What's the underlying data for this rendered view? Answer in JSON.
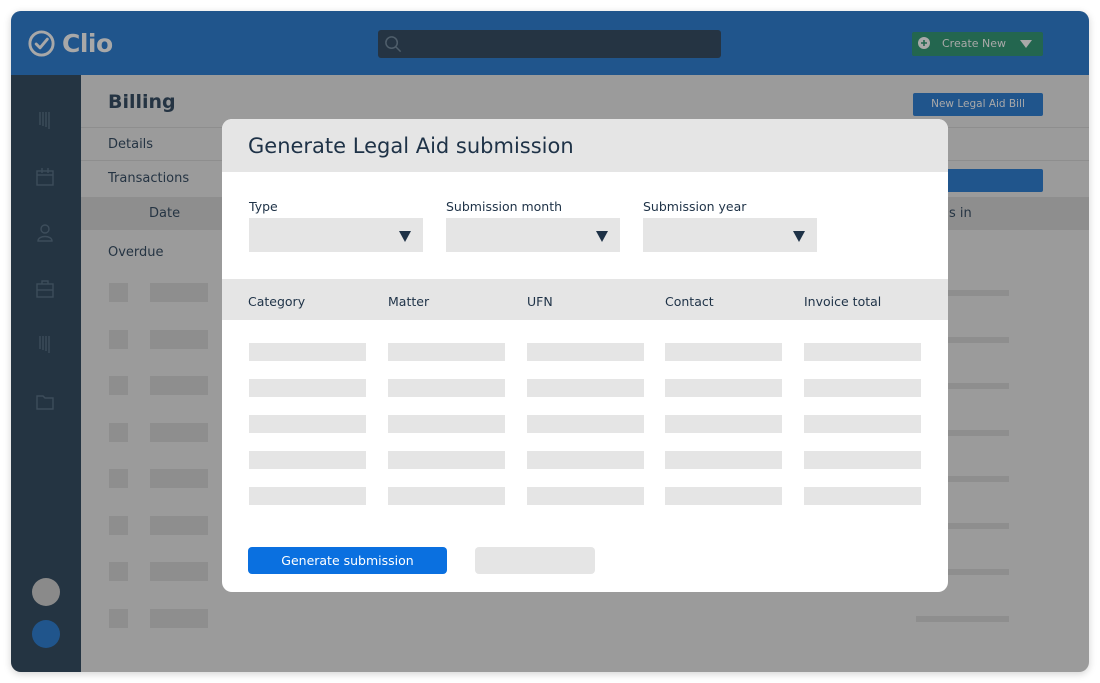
{
  "header": {
    "app_name": "Clio",
    "logo_icon": "check-circle-icon",
    "search": {
      "placeholder": "",
      "icon": "search-icon"
    },
    "create_new": {
      "label": "Create New",
      "icon": "plus-circle-icon",
      "menu_icon": "caret-down-icon"
    }
  },
  "sidebar": {
    "items": [
      {
        "name": "dashboard",
        "icon": "bars-icon"
      },
      {
        "name": "calendar",
        "icon": "calendar-icon"
      },
      {
        "name": "contacts",
        "icon": "person-icon"
      },
      {
        "name": "matters",
        "icon": "briefcase-icon"
      },
      {
        "name": "billing",
        "icon": "bars-icon"
      },
      {
        "name": "documents",
        "icon": "folder-icon"
      }
    ],
    "dots": [
      {
        "name": "user-avatar",
        "color": "#8a8a8a"
      },
      {
        "name": "status-indicator",
        "color": "#20558c"
      }
    ]
  },
  "background_page": {
    "title": "Billing",
    "new_bill_button": "New Legal Aid Bill",
    "tabs": [
      "Details",
      "Transactions"
    ],
    "columns": {
      "date": "Date",
      "right_partial": "s in"
    },
    "section": "Overdue"
  },
  "modal": {
    "title": "Generate Legal Aid submission",
    "fields": [
      {
        "label": "Type",
        "value": ""
      },
      {
        "label": "Submission month",
        "value": ""
      },
      {
        "label": "Submission year",
        "value": ""
      }
    ],
    "table": {
      "columns": [
        "Category",
        "Matter",
        "UFN",
        "Contact",
        "Invoice total"
      ],
      "row_count": 5
    },
    "primary_button": "Generate submission",
    "secondary_button": ""
  },
  "colors": {
    "header_blue": "#20558c",
    "sidebar_dark": "#243442",
    "primary_blue": "#0a70e0",
    "create_green": "#23664f",
    "text_dark": "#1e3247"
  }
}
